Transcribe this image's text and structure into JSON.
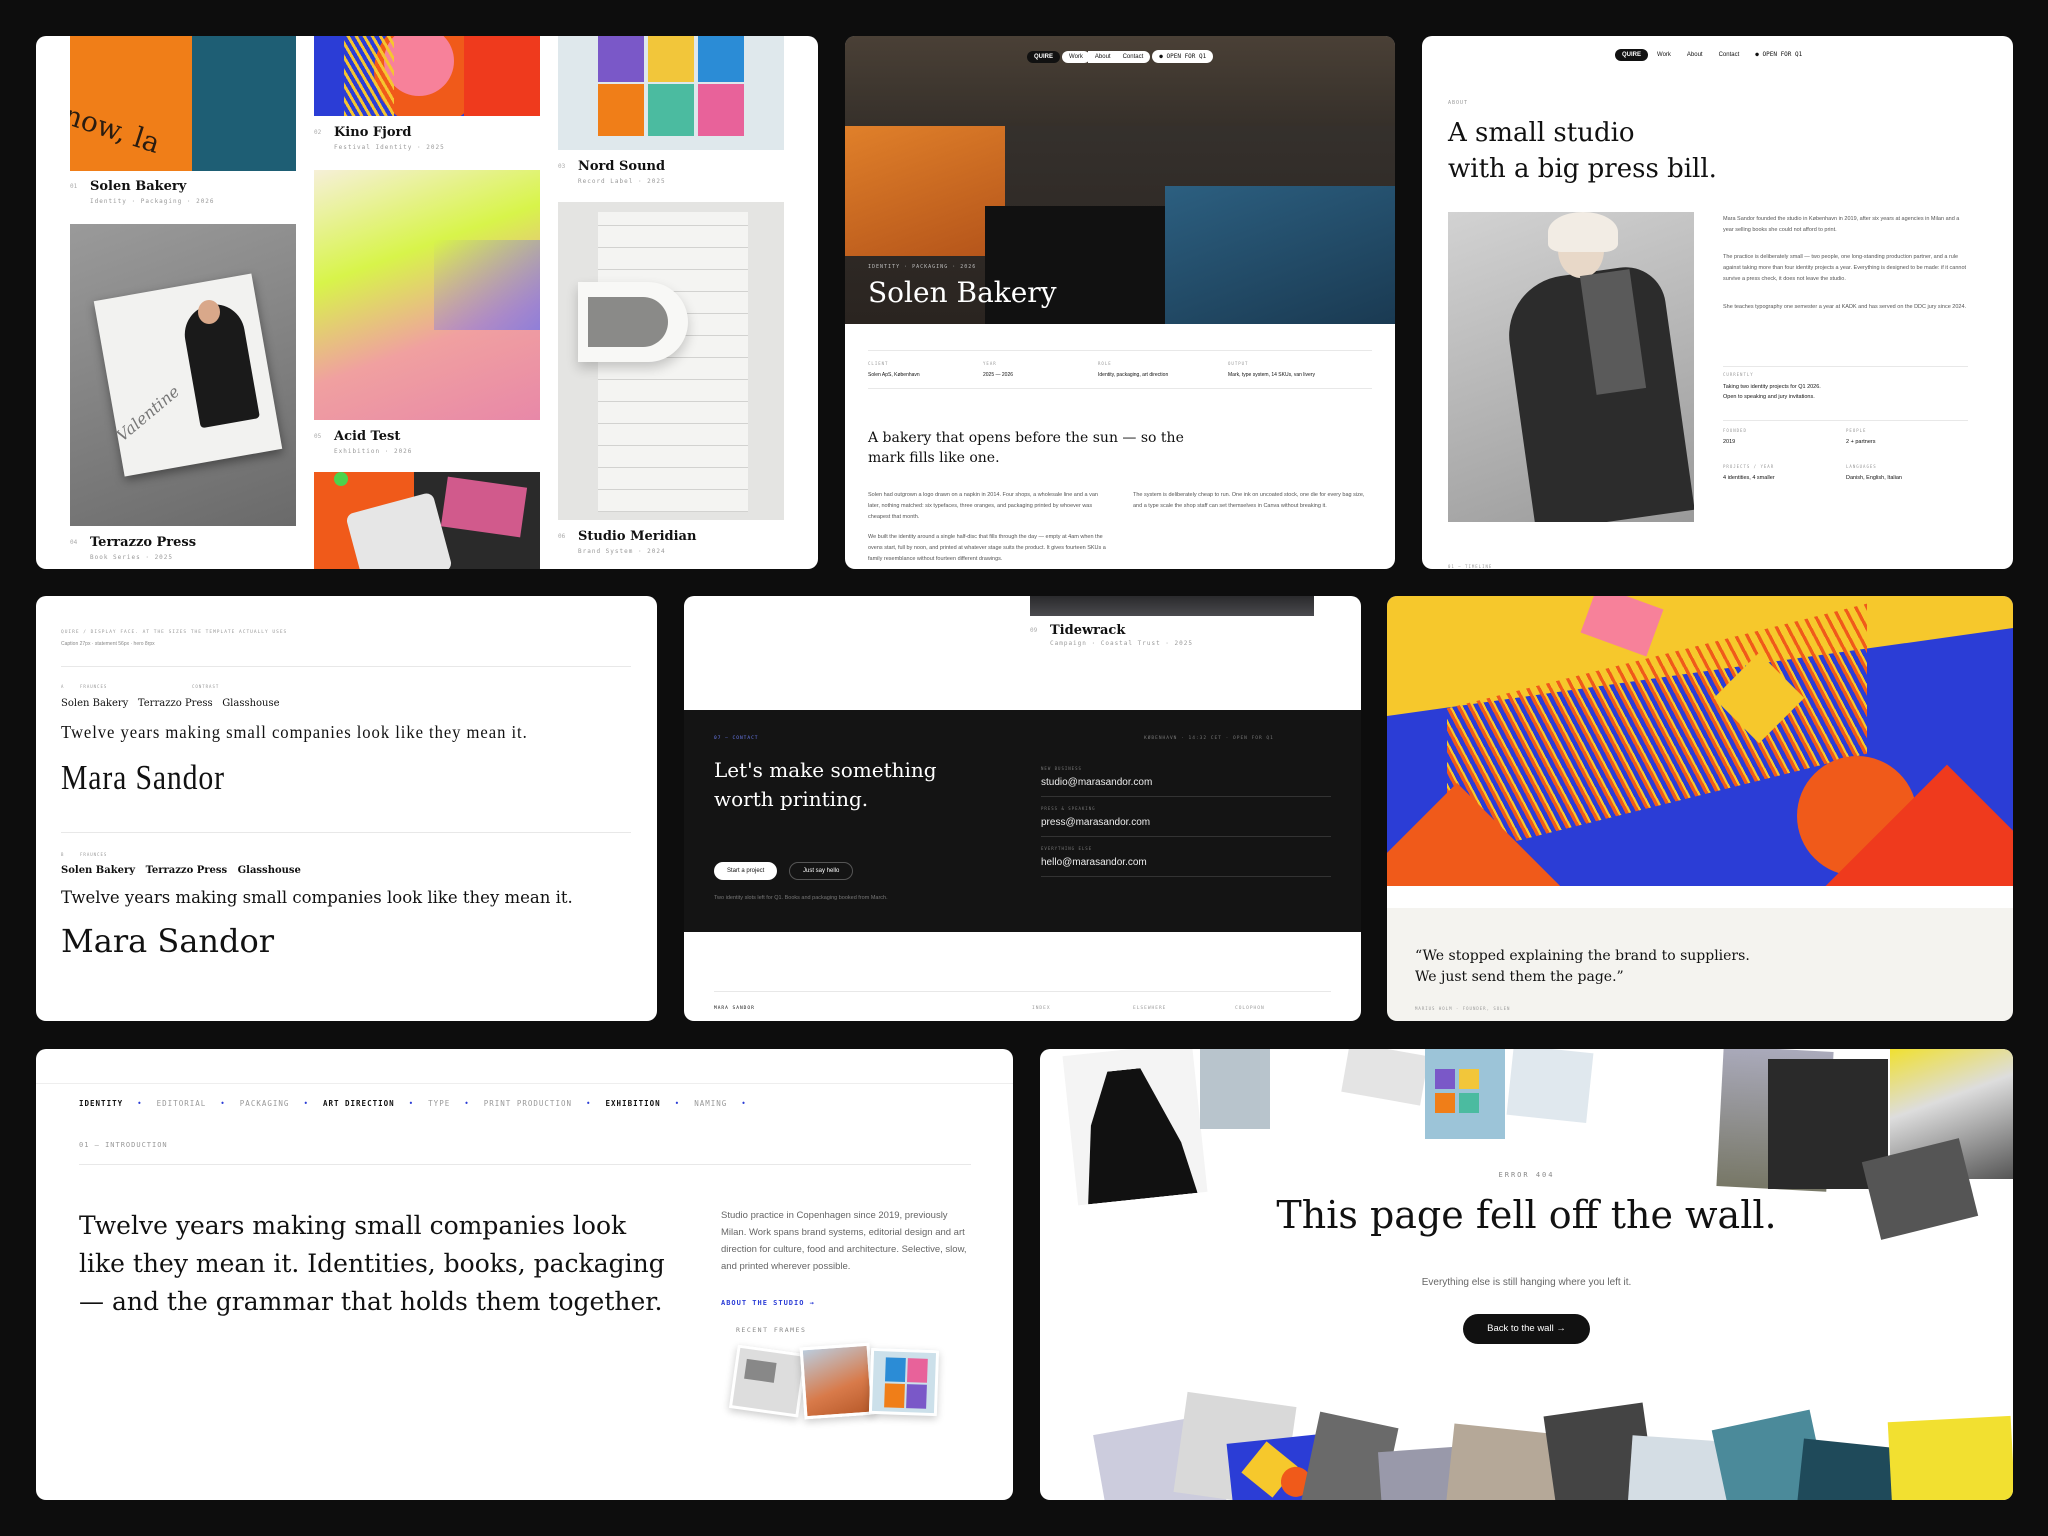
{
  "p1": {
    "items": [
      {
        "num": "01",
        "title": "Solen Bakery",
        "sub": "Identity · Packaging · 2026"
      },
      {
        "num": "02",
        "title": "Kino Fjord",
        "sub": "Festival Identity · 2025"
      },
      {
        "num": "03",
        "title": "Nord Sound",
        "sub": "Record Label · 2025"
      },
      {
        "num": "04",
        "title": "Terrazzo Press",
        "sub": "Book Series · 2025"
      },
      {
        "num": "05",
        "title": "Acid Test",
        "sub": "Exhibition · 2026"
      },
      {
        "num": "06",
        "title": "Studio Meridian",
        "sub": "Brand System · 2024"
      }
    ],
    "cover_text": "now, la",
    "book_text": "Valentine"
  },
  "p2": {
    "nav": {
      "logo": "QUIRE",
      "links": [
        "Work",
        "About",
        "Contact"
      ],
      "status": "● OPEN FOR Q1"
    },
    "hero_tag": "IDENTITY · PACKAGING · 2026",
    "hero_title": "Solen Bakery",
    "meta": [
      {
        "label": "CLIENT",
        "value": "Solen ApS, København"
      },
      {
        "label": "YEAR",
        "value": "2025 — 2026"
      },
      {
        "label": "ROLE",
        "value": "Identity, packaging, art direction"
      },
      {
        "label": "OUTPUT",
        "value": "Mark, type system, 14 SKUs, van livery"
      }
    ],
    "lead": "A bakery that opens before the sun — so the mark fills like one.",
    "body_left_1": "Solen had outgrown a logo drawn on a napkin in 2014. Four shops, a wholesale line and a van later, nothing matched: six typefaces, three oranges, and packaging printed by whoever was cheapest that month.",
    "body_left_2": "We built the identity around a single half-disc that fills through the day — empty at 4am when the ovens start, full by noon, and printed at whatever stage suits the product. It gives fourteen SKUs a family resemblance without fourteen different drawings.",
    "body_right": "The system is deliberately cheap to run. One ink on uncoated stock, one die for every bag size, and a type scale the shop staff can set themselves in Canva without breaking it."
  },
  "p3": {
    "nav": {
      "logo": "QUIRE",
      "links": [
        "Work",
        "About",
        "Contact"
      ],
      "status": "● OPEN FOR Q1"
    },
    "tag": "ABOUT",
    "title_1": "A small studio",
    "title_2": "with a big press bill.",
    "para_1": "Mara Sandor founded the studio in København in 2019, after six years at agencies in Milan and a year selling books she could not afford to print.",
    "para_2": "The practice is deliberately small — two people, one long-standing production partner, and a rule against taking more than four identity projects a year. Everything is designed to be made: if it cannot survive a press check, it does not leave the studio.",
    "para_3": "She teaches typography one semester a year at KADK and has served on the DDC jury since 2024.",
    "currently_label": "CURRENTLY",
    "currently_1": "Taking two identity projects for Q1 2026.",
    "currently_2": "Open to speaking and jury invitations.",
    "facts": [
      {
        "label": "FOUNDED",
        "value": "2019"
      },
      {
        "label": "PEOPLE",
        "value": "2 + partners"
      },
      {
        "label": "PROJECTS / YEAR",
        "value": "4 identities, 4 smaller"
      },
      {
        "label": "LANGUAGES",
        "value": "Danish, English, Italian"
      }
    ],
    "footer": "01 — TIMELINE"
  },
  "p4": {
    "header": "QUIRE / DISPLAY FACE. AT THE SIZES THE TEMPLATE ACTUALLY USES",
    "spec": "Caption 27px · statement 56px · hero 8rpx",
    "a_num": "A",
    "a_label": "FRAUNCES",
    "a_side": "CONTRAST",
    "a_names": [
      "Solen Bakery",
      "Terrazzo Press",
      "Glasshouse"
    ],
    "a_statement": "Twelve years making small companies look like they mean it.",
    "a_hero": "Mara Sandor",
    "b_num": "B",
    "b_label": "FRAUNCES",
    "b_names": [
      "Solen Bakery",
      "Terrazzo Press",
      "Glasshouse"
    ],
    "b_statement": "Twelve years making small companies look like they mean it.",
    "b_hero": "Mara Sandor"
  },
  "p5": {
    "top_num": "09",
    "top_title": "Tidewrack",
    "top_sub": "Campaign · Coastal Trust · 2025",
    "section": "07 — CONTACT",
    "locale": "KØBENHAVN · 14:32 CET · OPEN FOR Q1",
    "headline_1": "Let's make something",
    "headline_2": "worth printing.",
    "btn_primary": "Start a project",
    "btn_secondary": "Just say hello",
    "note": "Two identity slots left for Q1. Books and packaging booked from March.",
    "contacts": [
      {
        "label": "NEW BUSINESS",
        "value": "studio@marasandor.com"
      },
      {
        "label": "PRESS & SPEAKING",
        "value": "press@marasandor.com"
      },
      {
        "label": "EVERYTHING ELSE",
        "value": "hello@marasandor.com"
      }
    ],
    "footer_brand": "MARA SANDOR",
    "footer_links": [
      "Index",
      "Elsewhere",
      "Colophon"
    ]
  },
  "p6": {
    "quote_1": "“We stopped explaining the brand to suppliers.",
    "quote_2": "We just send them the page.”",
    "attribution": "MARIUS HOLM · FOUNDER, SOLEN"
  },
  "p7": {
    "tags": [
      "IDENTITY",
      "EDITORIAL",
      "PACKAGING",
      "ART DIRECTION",
      "TYPE",
      "PRINT PRODUCTION",
      "EXHIBITION",
      "NAMING"
    ],
    "section": "01 — INTRODUCTION",
    "headline_1": "Twelve years making small companies look",
    "headline_2": "like they mean it. Identities, books, packaging",
    "headline_3": "— and the grammar that holds them together.",
    "body": "Studio practice in Copenhagen since 2019, previously Milan. Work spans brand systems, editorial design and art direction for culture, food and architecture. Selective, slow, and printed wherever possible.",
    "link": "ABOUT THE STUDIO →",
    "frames_label": "RECENT FRAMES"
  },
  "p8": {
    "error": "ERROR 404",
    "title": "This page fell off the wall.",
    "sub": "Everything else is still hanging where you left it.",
    "button": "Back to the wall →"
  },
  "colors": {
    "accent": "#2b3dd6",
    "orange": "#f0671a",
    "dark": "#141414",
    "bg": "#0d0d0d"
  }
}
